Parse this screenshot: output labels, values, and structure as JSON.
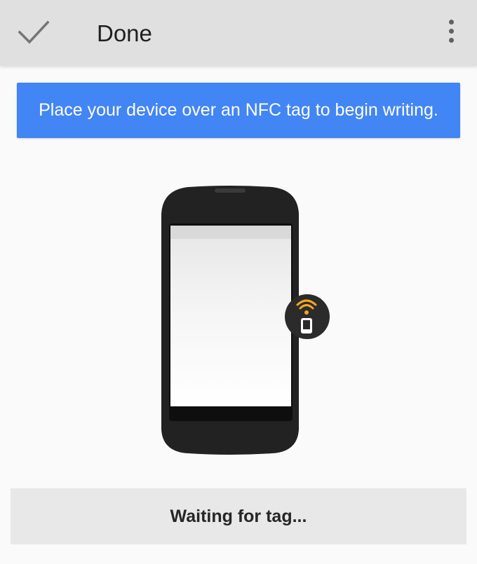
{
  "toolbar": {
    "done_label": "Done",
    "done_icon": "check-icon",
    "overflow_icon": "more-vert-icon"
  },
  "banner": {
    "message": "Place your device over an NFC tag to begin writing.",
    "color": "#4285f4"
  },
  "illustration": {
    "phone_icon": "phone-illustration",
    "nfc_icon": "nfc-tag-icon",
    "accent_color": "#f5a623"
  },
  "status": {
    "text": "Waiting for tag..."
  }
}
